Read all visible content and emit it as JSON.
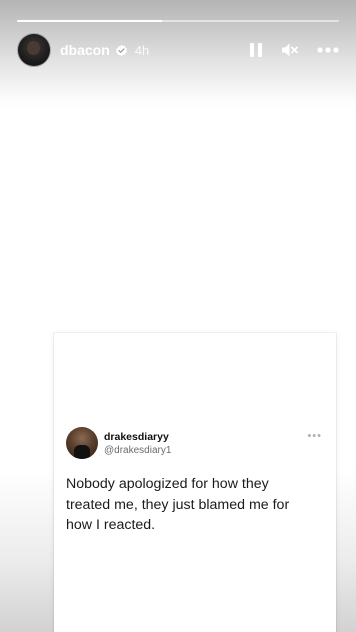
{
  "story": {
    "progress": 0.45,
    "user": {
      "username": "dbacon",
      "verified": true,
      "time_ago": "4h"
    },
    "controls": {
      "pause_icon": "pause-icon",
      "mute_icon": "muted-speaker-icon",
      "more_icon": "more-options-icon"
    }
  },
  "tweet": {
    "display_name": "drakesdiaryy",
    "handle": "@drakesdiary1",
    "text": "Nobody apologized for how they treated me, they just blamed me for how I reacted.",
    "more": "•••"
  },
  "footer": {
    "like_icon": "heart-icon"
  },
  "colors": {
    "verified_badge": "#ffffff",
    "text_dark": "#1b1b1b",
    "handle_gray": "#6b6b6b"
  }
}
